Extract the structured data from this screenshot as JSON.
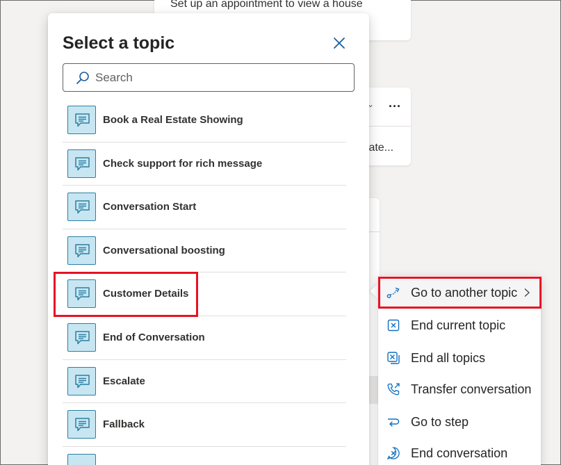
{
  "canvas": {
    "card_message": "Set up an appointment to view a house",
    "card_truncated_text": "tate...",
    "more_label": "..."
  },
  "picker": {
    "title": "Select a topic",
    "search_placeholder": "Search",
    "topics": [
      {
        "label": "Book a Real Estate Showing"
      },
      {
        "label": "Check support for rich message"
      },
      {
        "label": "Conversation Start"
      },
      {
        "label": "Conversational boosting"
      },
      {
        "label": "Customer Details"
      },
      {
        "label": "End of Conversation"
      },
      {
        "label": "Escalate"
      },
      {
        "label": "Fallback"
      }
    ]
  },
  "menu": {
    "items": [
      {
        "label": "Go to another topic",
        "icon": "redirect-icon"
      },
      {
        "label": "End current topic",
        "icon": "end-topic-icon"
      },
      {
        "label": "End all topics",
        "icon": "end-all-icon"
      },
      {
        "label": "Transfer conversation",
        "icon": "transfer-icon"
      },
      {
        "label": "Go to step",
        "icon": "goto-step-icon"
      },
      {
        "label": "End conversation",
        "icon": "end-conversation-icon"
      }
    ]
  },
  "colors": {
    "accent": "#2c7fa3",
    "icon_fill": "#c7e6f1",
    "highlight": "#e81123",
    "menu_icon": "#106ebe"
  }
}
